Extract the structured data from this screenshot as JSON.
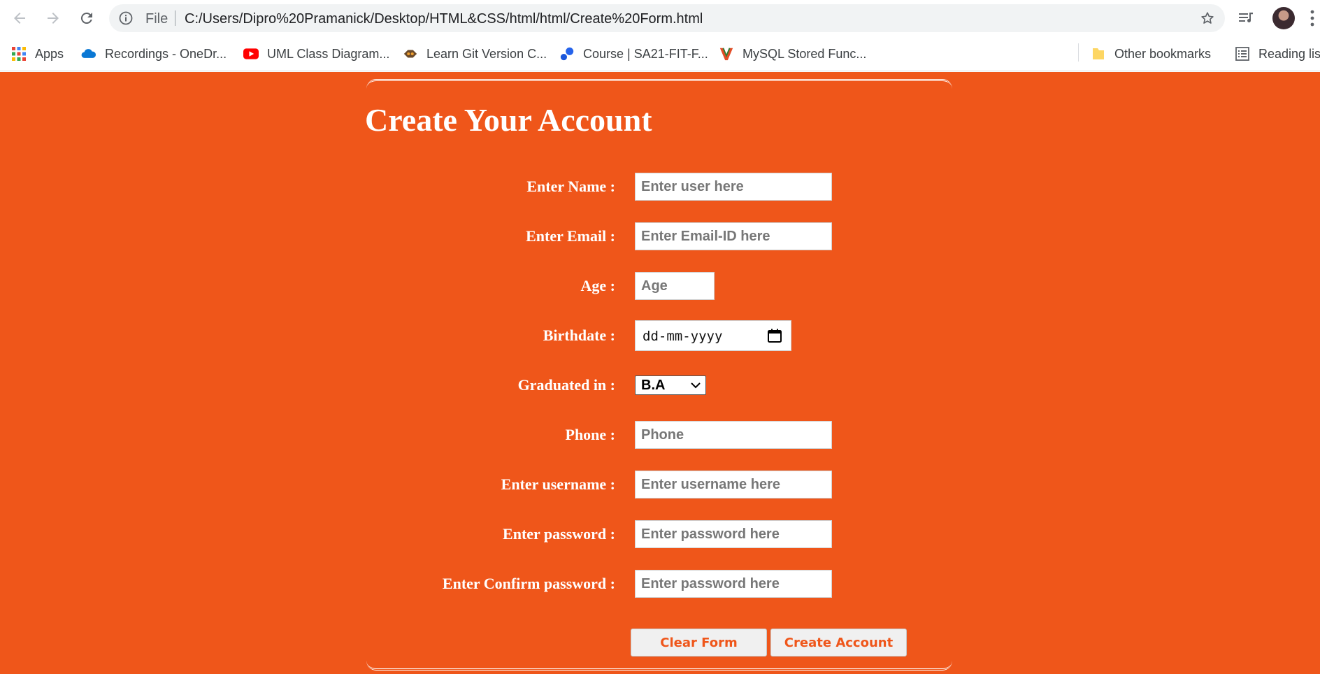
{
  "browser": {
    "omnibox": {
      "scheme_label": "File",
      "url": "C:/Users/Dipro%20Pramanick/Desktop/HTML&CSS/html/html/Create%20Form.html"
    },
    "bookmarks": [
      {
        "label": "Apps",
        "icon": "apps-grid-icon"
      },
      {
        "label": "Recordings - OneDr...",
        "icon": "onedrive-icon"
      },
      {
        "label": "UML Class Diagram...",
        "icon": "youtube-icon"
      },
      {
        "label": "Learn Git Version C...",
        "icon": "git-course-icon"
      },
      {
        "label": "Course | SA21-FIT-F...",
        "icon": "course-icon"
      },
      {
        "label": "MySQL Stored Func...",
        "icon": "mysql-icon"
      }
    ],
    "other_bookmarks": "Other bookmarks",
    "reading_list": "Reading lis"
  },
  "form": {
    "title": "Create Your Account",
    "name": {
      "label": "Enter Name :",
      "placeholder": "Enter user here"
    },
    "email": {
      "label": "Enter Email :",
      "placeholder": "Enter Email-ID here"
    },
    "age": {
      "label": "Age :",
      "placeholder": "Age"
    },
    "birthdate": {
      "label": "Birthdate :",
      "value": "dd-mm-yyyy"
    },
    "graduated": {
      "label": "Graduated in :",
      "selected": "B.A"
    },
    "phone": {
      "label": "Phone :",
      "placeholder": "Phone"
    },
    "username": {
      "label": "Enter username :",
      "placeholder": "Enter username here"
    },
    "password": {
      "label": "Enter password :",
      "placeholder": "Enter password here"
    },
    "confirm_password": {
      "label": "Enter Confirm password :",
      "placeholder": "Enter password here"
    },
    "buttons": {
      "clear": "Clear Form",
      "create": "Create Account"
    }
  },
  "colors": {
    "page_background": "#ef561a",
    "button_text": "#ef561a",
    "label_text": "#ffffff"
  }
}
